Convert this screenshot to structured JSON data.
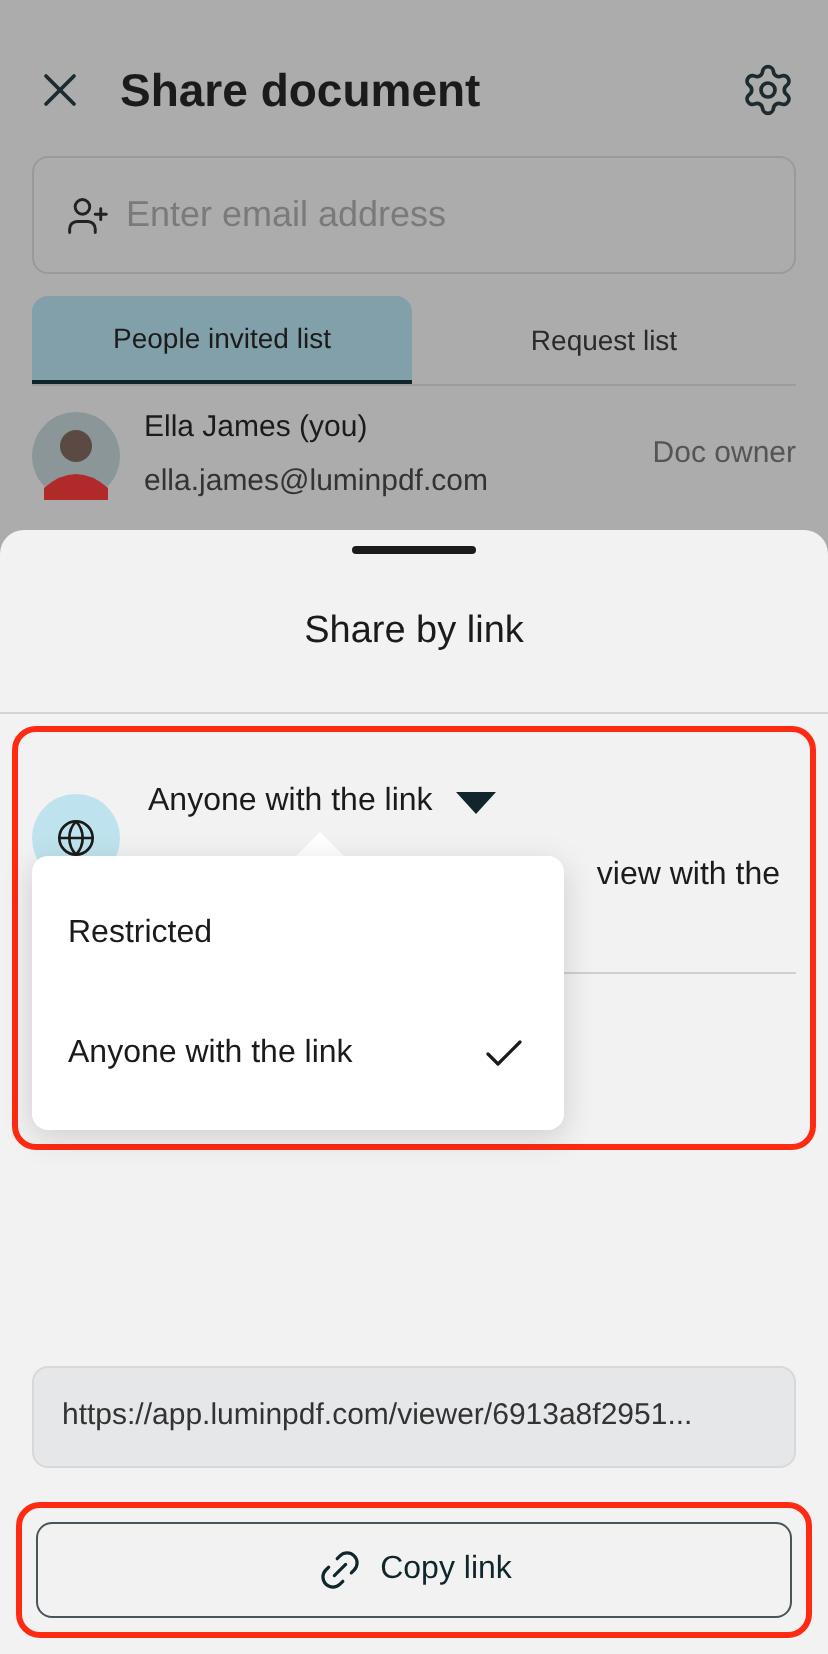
{
  "header": {
    "title": "Share document"
  },
  "email_field": {
    "placeholder": "Enter email address"
  },
  "tabs": [
    {
      "label": "People invited list",
      "selected": true
    },
    {
      "label": "Request list",
      "selected": false
    }
  ],
  "members": [
    {
      "name": "Ella James (you)",
      "email": "ella.james@luminpdf.com",
      "role": "Doc owner"
    }
  ],
  "sheet": {
    "title": "Share by link",
    "access": {
      "label": "Anyone with the link",
      "description_visible": "view with the"
    },
    "link": "https://app.luminpdf.com/viewer/6913a8f2951...",
    "copy_button": "Copy link"
  },
  "menu": {
    "options": [
      {
        "label": "Restricted",
        "selected": false
      },
      {
        "label": "Anyone with the link",
        "selected": true
      }
    ]
  }
}
